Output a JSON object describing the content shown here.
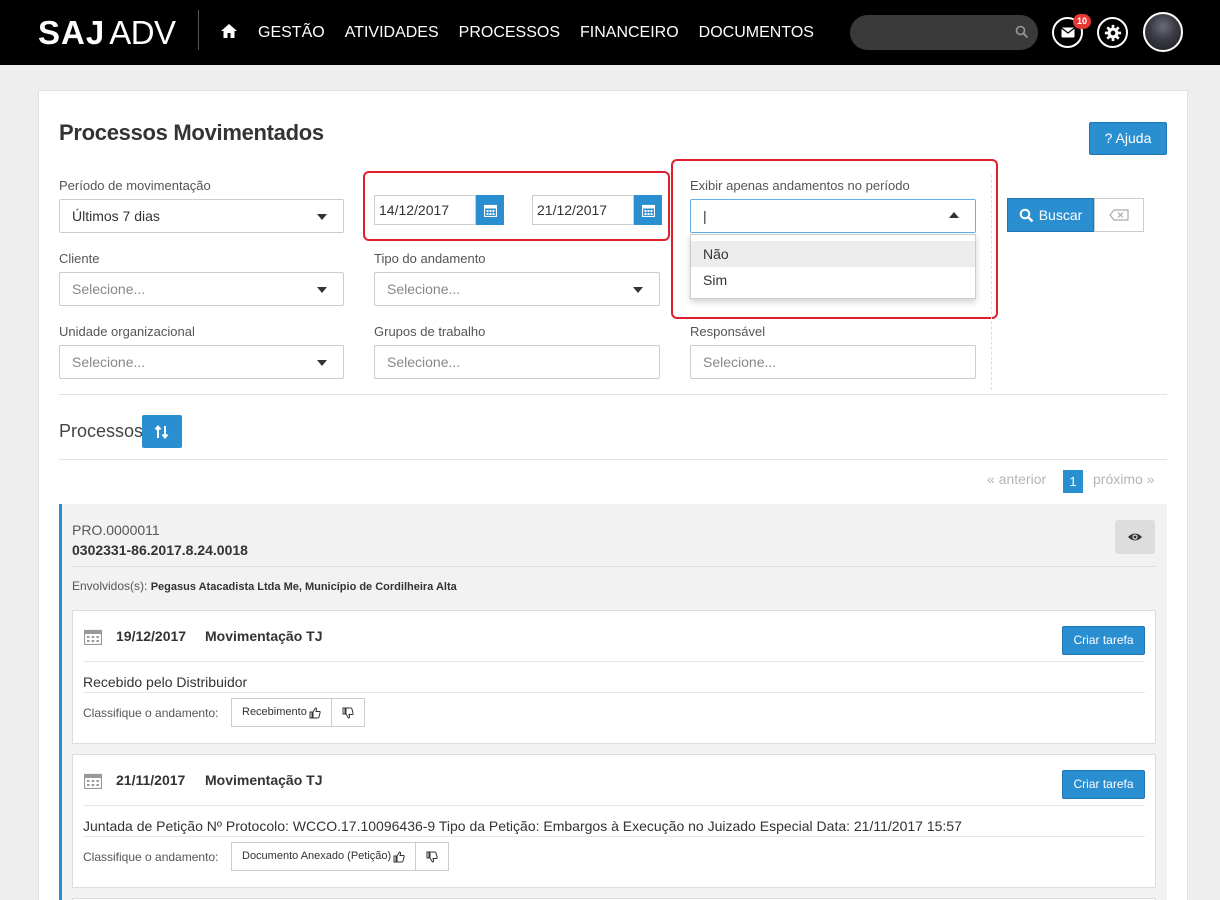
{
  "app": {
    "logo_saj": "SAJ",
    "logo_adv": "ADV"
  },
  "nav": [
    "GESTÃO",
    "ATIVIDADES",
    "PROCESSOS",
    "FINANCEIRO",
    "DOCUMENTOS"
  ],
  "header": {
    "notification_count": "10",
    "search_value": ""
  },
  "page": {
    "title": "Processos Movimentados",
    "help_label": "? Ajuda"
  },
  "filters": {
    "periodo_label": "Período de movimentação",
    "periodo_value": "Últimos 7 dias",
    "date_from": "14/12/2017",
    "date_to": "21/12/2017",
    "exibir_label": "Exibir apenas andamentos no período",
    "exibir_value": "|",
    "exibir_options": [
      "Não",
      "Sim"
    ],
    "cliente_label": "Cliente",
    "cliente_placeholder": "Selecione...",
    "tipo_label": "Tipo do andamento",
    "tipo_placeholder": "Selecione...",
    "unidade_label": "Unidade organizacional",
    "unidade_placeholder": "Selecione...",
    "grupos_label": "Grupos de trabalho",
    "grupos_placeholder": "Selecione...",
    "responsavel_label": "Responsável",
    "responsavel_placeholder": "Selecione..."
  },
  "actions": {
    "buscar_label": "Buscar"
  },
  "processes": {
    "section_title": "Processos",
    "pager": {
      "prev": "« anterior",
      "current": "1",
      "next": "próximo »"
    },
    "items": [
      {
        "code": "PRO.0000011",
        "number": "0302331-86.2017.8.24.0018",
        "involved_label": "Envolvidos(s):",
        "involved": "Pegasus Atacadista Ltda Me, Município de Cordilheira Alta",
        "movements": [
          {
            "date": "19/12/2017",
            "type": "Movimentação TJ",
            "task_label": "Criar tarefa",
            "description": "Recebido pelo Distribuidor",
            "classify_label": "Classifique o andamento:",
            "classify_value": "Recebimento"
          },
          {
            "date": "21/11/2017",
            "type": "Movimentação TJ",
            "task_label": "Criar tarefa",
            "description": "Juntada de Petição Nº Protocolo: WCCO.17.10096436-9 Tipo da Petição: Embargos à Execução no Juizado Especial Data: 21/11/2017 15:57",
            "classify_label": "Classifique o andamento:",
            "classify_value": "Documento Anexado (Petição)"
          }
        ]
      }
    ]
  },
  "colors": {
    "primary": "#2a8fd0",
    "highlight": "#e0202a",
    "topbar": "#000000"
  },
  "icons": [
    "home-icon",
    "search-icon",
    "mail-icon",
    "gear-icon",
    "calendar-icon",
    "magnifier-icon",
    "eraser-icon",
    "sort-icon",
    "eye-icon",
    "thumbs-up-icon",
    "thumbs-down-icon"
  ]
}
